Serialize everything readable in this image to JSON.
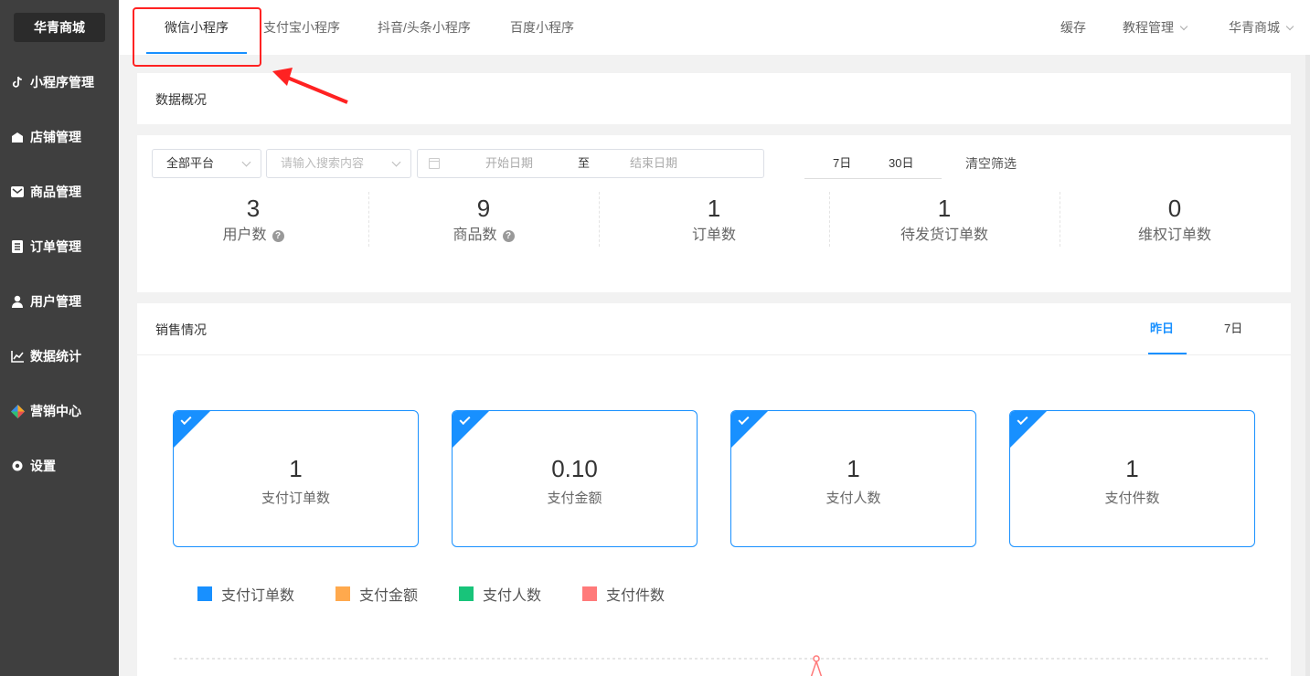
{
  "sidebar": {
    "brand": "华青商城",
    "items": [
      {
        "label": "小程序管理",
        "icon": "tiktok-icon"
      },
      {
        "label": "店铺管理",
        "icon": "store-icon"
      },
      {
        "label": "商品管理",
        "icon": "mail-icon"
      },
      {
        "label": "订单管理",
        "icon": "list-icon"
      },
      {
        "label": "用户管理",
        "icon": "user-icon"
      },
      {
        "label": "数据统计",
        "icon": "chart-icon"
      },
      {
        "label": "营销中心",
        "icon": "marketing-icon"
      },
      {
        "label": "设置",
        "icon": "gear-icon"
      }
    ]
  },
  "header": {
    "tabs": [
      {
        "label": "微信小程序",
        "active": true
      },
      {
        "label": "支付宝小程序",
        "active": false
      },
      {
        "label": "抖音/头条小程序",
        "active": false
      },
      {
        "label": "百度小程序",
        "active": false
      }
    ],
    "cache": "缓存",
    "tutorial": "教程管理",
    "shop": "华青商城"
  },
  "overview": {
    "title": "数据概况"
  },
  "filters": {
    "platform": "全部平台",
    "search_placeholder": "请输入搜索内容",
    "start_placeholder": "开始日期",
    "to": "至",
    "end_placeholder": "结束日期",
    "range_7": "7日",
    "range_30": "30日",
    "clear": "清空筛选"
  },
  "stats": [
    {
      "value": "3",
      "label": "用户数",
      "help": true
    },
    {
      "value": "9",
      "label": "商品数",
      "help": true
    },
    {
      "value": "1",
      "label": "订单数",
      "help": false
    },
    {
      "value": "1",
      "label": "待发货订单数",
      "help": false
    },
    {
      "value": "0",
      "label": "维权订单数",
      "help": false
    }
  ],
  "sales": {
    "title": "销售情况",
    "tab_yesterday": "昨日",
    "tab_7": "7日",
    "cards": [
      {
        "value": "1",
        "label": "支付订单数"
      },
      {
        "value": "0.10",
        "label": "支付金额"
      },
      {
        "value": "1",
        "label": "支付人数"
      },
      {
        "value": "1",
        "label": "支付件数"
      }
    ],
    "legend": [
      {
        "label": "支付订单数",
        "color": "#1890ff"
      },
      {
        "label": "支付金额",
        "color": "#ffa94d"
      },
      {
        "label": "支付人数",
        "color": "#18c47a"
      },
      {
        "label": "支付件数",
        "color": "#ff7a7a"
      }
    ]
  },
  "colors": {
    "accent": "#1890ff",
    "sidebar_bg": "#3f3f3f",
    "highlight": "#ff2222"
  }
}
